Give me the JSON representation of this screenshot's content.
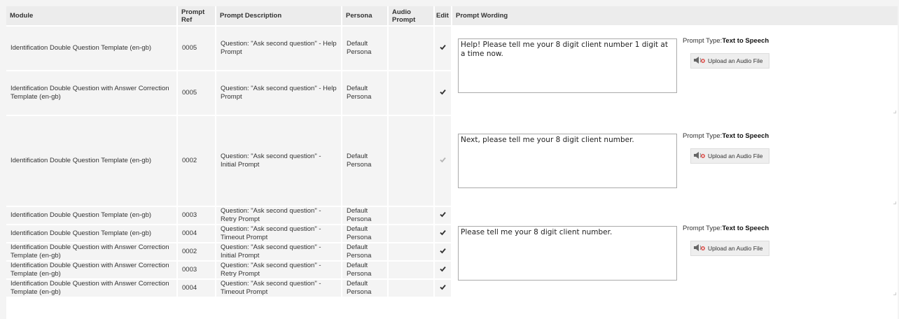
{
  "headers": {
    "module": "Module",
    "prompt_ref": "Prompt Ref",
    "prompt_description": "Prompt Description",
    "persona": "Persona",
    "audio_prompt": "Audio Prompt",
    "edit": "Edit",
    "prompt_wording": "Prompt Wording"
  },
  "rows": [
    {
      "module": "Identification Double Question Template (en-gb)",
      "ref": "0005",
      "description": "Question: \"Ask second question\" - Help Prompt",
      "persona": "Default Persona",
      "audio": "",
      "edit_checked": true,
      "edit_enabled": true
    },
    {
      "module": "Identification Double Question with Answer Correction Template (en-gb)",
      "ref": "0005",
      "description": "Question: \"Ask second question\" - Help Prompt",
      "persona": "Default Persona",
      "audio": "",
      "edit_checked": true,
      "edit_enabled": true
    },
    {
      "module": "Identification Double Question Template (en-gb)",
      "ref": "0002",
      "description": "Question: \"Ask second question\" - Initial Prompt",
      "persona": "Default Persona",
      "audio": "",
      "edit_checked": true,
      "edit_enabled": false
    },
    {
      "module": "Identification Double Question Template (en-gb)",
      "ref": "0003",
      "description": "Question: \"Ask second question\" - Retry Prompt",
      "persona": "Default Persona",
      "audio": "",
      "edit_checked": true,
      "edit_enabled": true
    },
    {
      "module": "Identification Double Question Template (en-gb)",
      "ref": "0004",
      "description": "Question: \"Ask second question\" - Timeout Prompt",
      "persona": "Default Persona",
      "audio": "",
      "edit_checked": true,
      "edit_enabled": true
    },
    {
      "module": "Identification Double Question with Answer Correction Template (en-gb)",
      "ref": "0002",
      "description": "Question: \"Ask second question\" - Initial Prompt",
      "persona": "Default Persona",
      "audio": "",
      "edit_checked": true,
      "edit_enabled": true
    },
    {
      "module": "Identification Double Question with Answer Correction Template (en-gb)",
      "ref": "0003",
      "description": "Question: \"Ask second question\" - Retry Prompt",
      "persona": "Default Persona",
      "audio": "",
      "edit_checked": true,
      "edit_enabled": true
    },
    {
      "module": "Identification Double Question with Answer Correction Template (en-gb)",
      "ref": "0004",
      "description": "Question: \"Ask second question\" - Timeout Prompt",
      "persona": "Default Persona",
      "audio": "",
      "edit_checked": true,
      "edit_enabled": true
    }
  ],
  "wording_groups": [
    {
      "text": "Help! Please tell me your 8 digit client number 1 digit at a time now.",
      "prompt_type_label": "Prompt Type:",
      "prompt_type_value": "Text to Speech",
      "upload_label": "Upload an Audio File",
      "upload_icon": "speaker-upload-icon"
    },
    {
      "text": "Next, please tell me your 8 digit client number.",
      "prompt_type_label": "Prompt Type:",
      "prompt_type_value": "Text to Speech",
      "upload_label": "Upload an Audio File",
      "upload_icon": "speaker-upload-icon"
    },
    {
      "text": "Please tell me your 8 digit client number.",
      "prompt_type_label": "Prompt Type:",
      "prompt_type_value": "Text to Speech",
      "upload_label": "Upload an Audio File",
      "upload_icon": "speaker-upload-icon"
    }
  ],
  "colors": {
    "header_bg": "#ececec",
    "cell_bg": "#f4f4f4",
    "checkbox": "#333333",
    "checkbox_disabled": "#b5b5b5"
  }
}
